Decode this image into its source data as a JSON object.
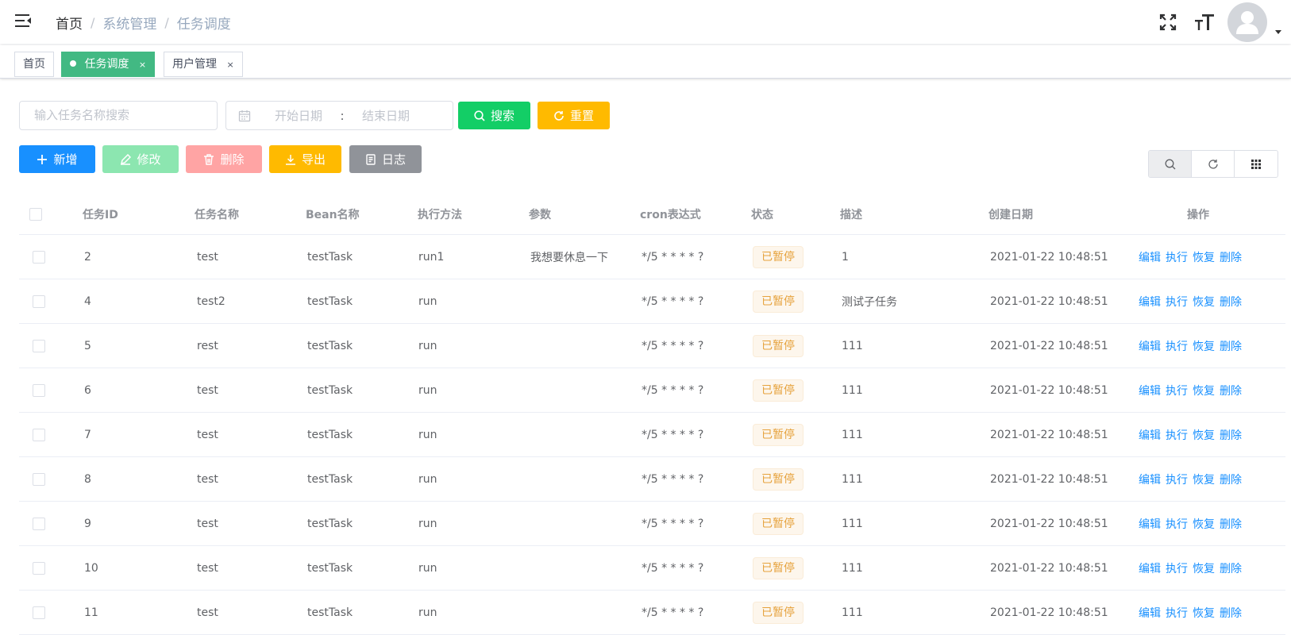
{
  "breadcrumb": {
    "home": "首页",
    "section": "系统管理",
    "current": "任务调度"
  },
  "tags": [
    {
      "label": "首页",
      "active": false,
      "closable": false
    },
    {
      "label": "任务调度",
      "active": true,
      "closable": true
    },
    {
      "label": "用户管理",
      "active": false,
      "closable": true
    }
  ],
  "tag_close": "×",
  "search": {
    "name_placeholder": "输入任务名称搜索",
    "start_placeholder": "开始日期",
    "range_separator": ":",
    "end_placeholder": "结束日期"
  },
  "buttons": {
    "search": "搜索",
    "reset": "重置",
    "add": "新增",
    "edit": "修改",
    "delete": "删除",
    "export": "导出",
    "log": "日志"
  },
  "table": {
    "headers": {
      "id": "任务ID",
      "name": "任务名称",
      "bean": "Bean名称",
      "method": "执行方法",
      "params": "参数",
      "cron": "cron表达式",
      "status": "状态",
      "desc": "描述",
      "created": "创建日期",
      "ops": "操作"
    },
    "ops": {
      "edit": "编辑",
      "run": "执行",
      "resume": "恢复",
      "delete": "删除"
    },
    "rows": [
      {
        "id": "2",
        "name": "test",
        "bean": "testTask",
        "method": "run1",
        "params": "我想要休息一下",
        "cron": "*/5 * * * * ?",
        "status": "已暂停",
        "desc": "1",
        "created": "2021-01-22 10:48:51"
      },
      {
        "id": "4",
        "name": "test2",
        "bean": "testTask",
        "method": "run",
        "params": "",
        "cron": "*/5 * * * * ?",
        "status": "已暂停",
        "desc": "测试子任务",
        "created": "2021-01-22 10:48:51"
      },
      {
        "id": "5",
        "name": "rest",
        "bean": "testTask",
        "method": "run",
        "params": "",
        "cron": "*/5 * * * * ?",
        "status": "已暂停",
        "desc": "111",
        "created": "2021-01-22 10:48:51"
      },
      {
        "id": "6",
        "name": "test",
        "bean": "testTask",
        "method": "run",
        "params": "",
        "cron": "*/5 * * * * ?",
        "status": "已暂停",
        "desc": "111",
        "created": "2021-01-22 10:48:51"
      },
      {
        "id": "7",
        "name": "test",
        "bean": "testTask",
        "method": "run",
        "params": "",
        "cron": "*/5 * * * * ?",
        "status": "已暂停",
        "desc": "111",
        "created": "2021-01-22 10:48:51"
      },
      {
        "id": "8",
        "name": "test",
        "bean": "testTask",
        "method": "run",
        "params": "",
        "cron": "*/5 * * * * ?",
        "status": "已暂停",
        "desc": "111",
        "created": "2021-01-22 10:48:51"
      },
      {
        "id": "9",
        "name": "test",
        "bean": "testTask",
        "method": "run",
        "params": "",
        "cron": "*/5 * * * * ?",
        "status": "已暂停",
        "desc": "111",
        "created": "2021-01-22 10:48:51"
      },
      {
        "id": "10",
        "name": "test",
        "bean": "testTask",
        "method": "run",
        "params": "",
        "cron": "*/5 * * * * ?",
        "status": "已暂停",
        "desc": "111",
        "created": "2021-01-22 10:48:51"
      },
      {
        "id": "11",
        "name": "test",
        "bean": "testTask",
        "method": "run",
        "params": "",
        "cron": "*/5 * * * * ?",
        "status": "已暂停",
        "desc": "111",
        "created": "2021-01-22 10:48:51"
      }
    ]
  },
  "colors": {
    "primary": "#1890ff",
    "success": "#13ce66",
    "warning": "#ffba00",
    "danger": "#ff4949",
    "info": "#909399",
    "tag_active": "#42b983"
  },
  "icons": {
    "menu": "hamburger-icon",
    "fullscreen": "fullscreen-icon",
    "font_size": "font-size-icon",
    "avatar": "user-avatar-icon"
  }
}
